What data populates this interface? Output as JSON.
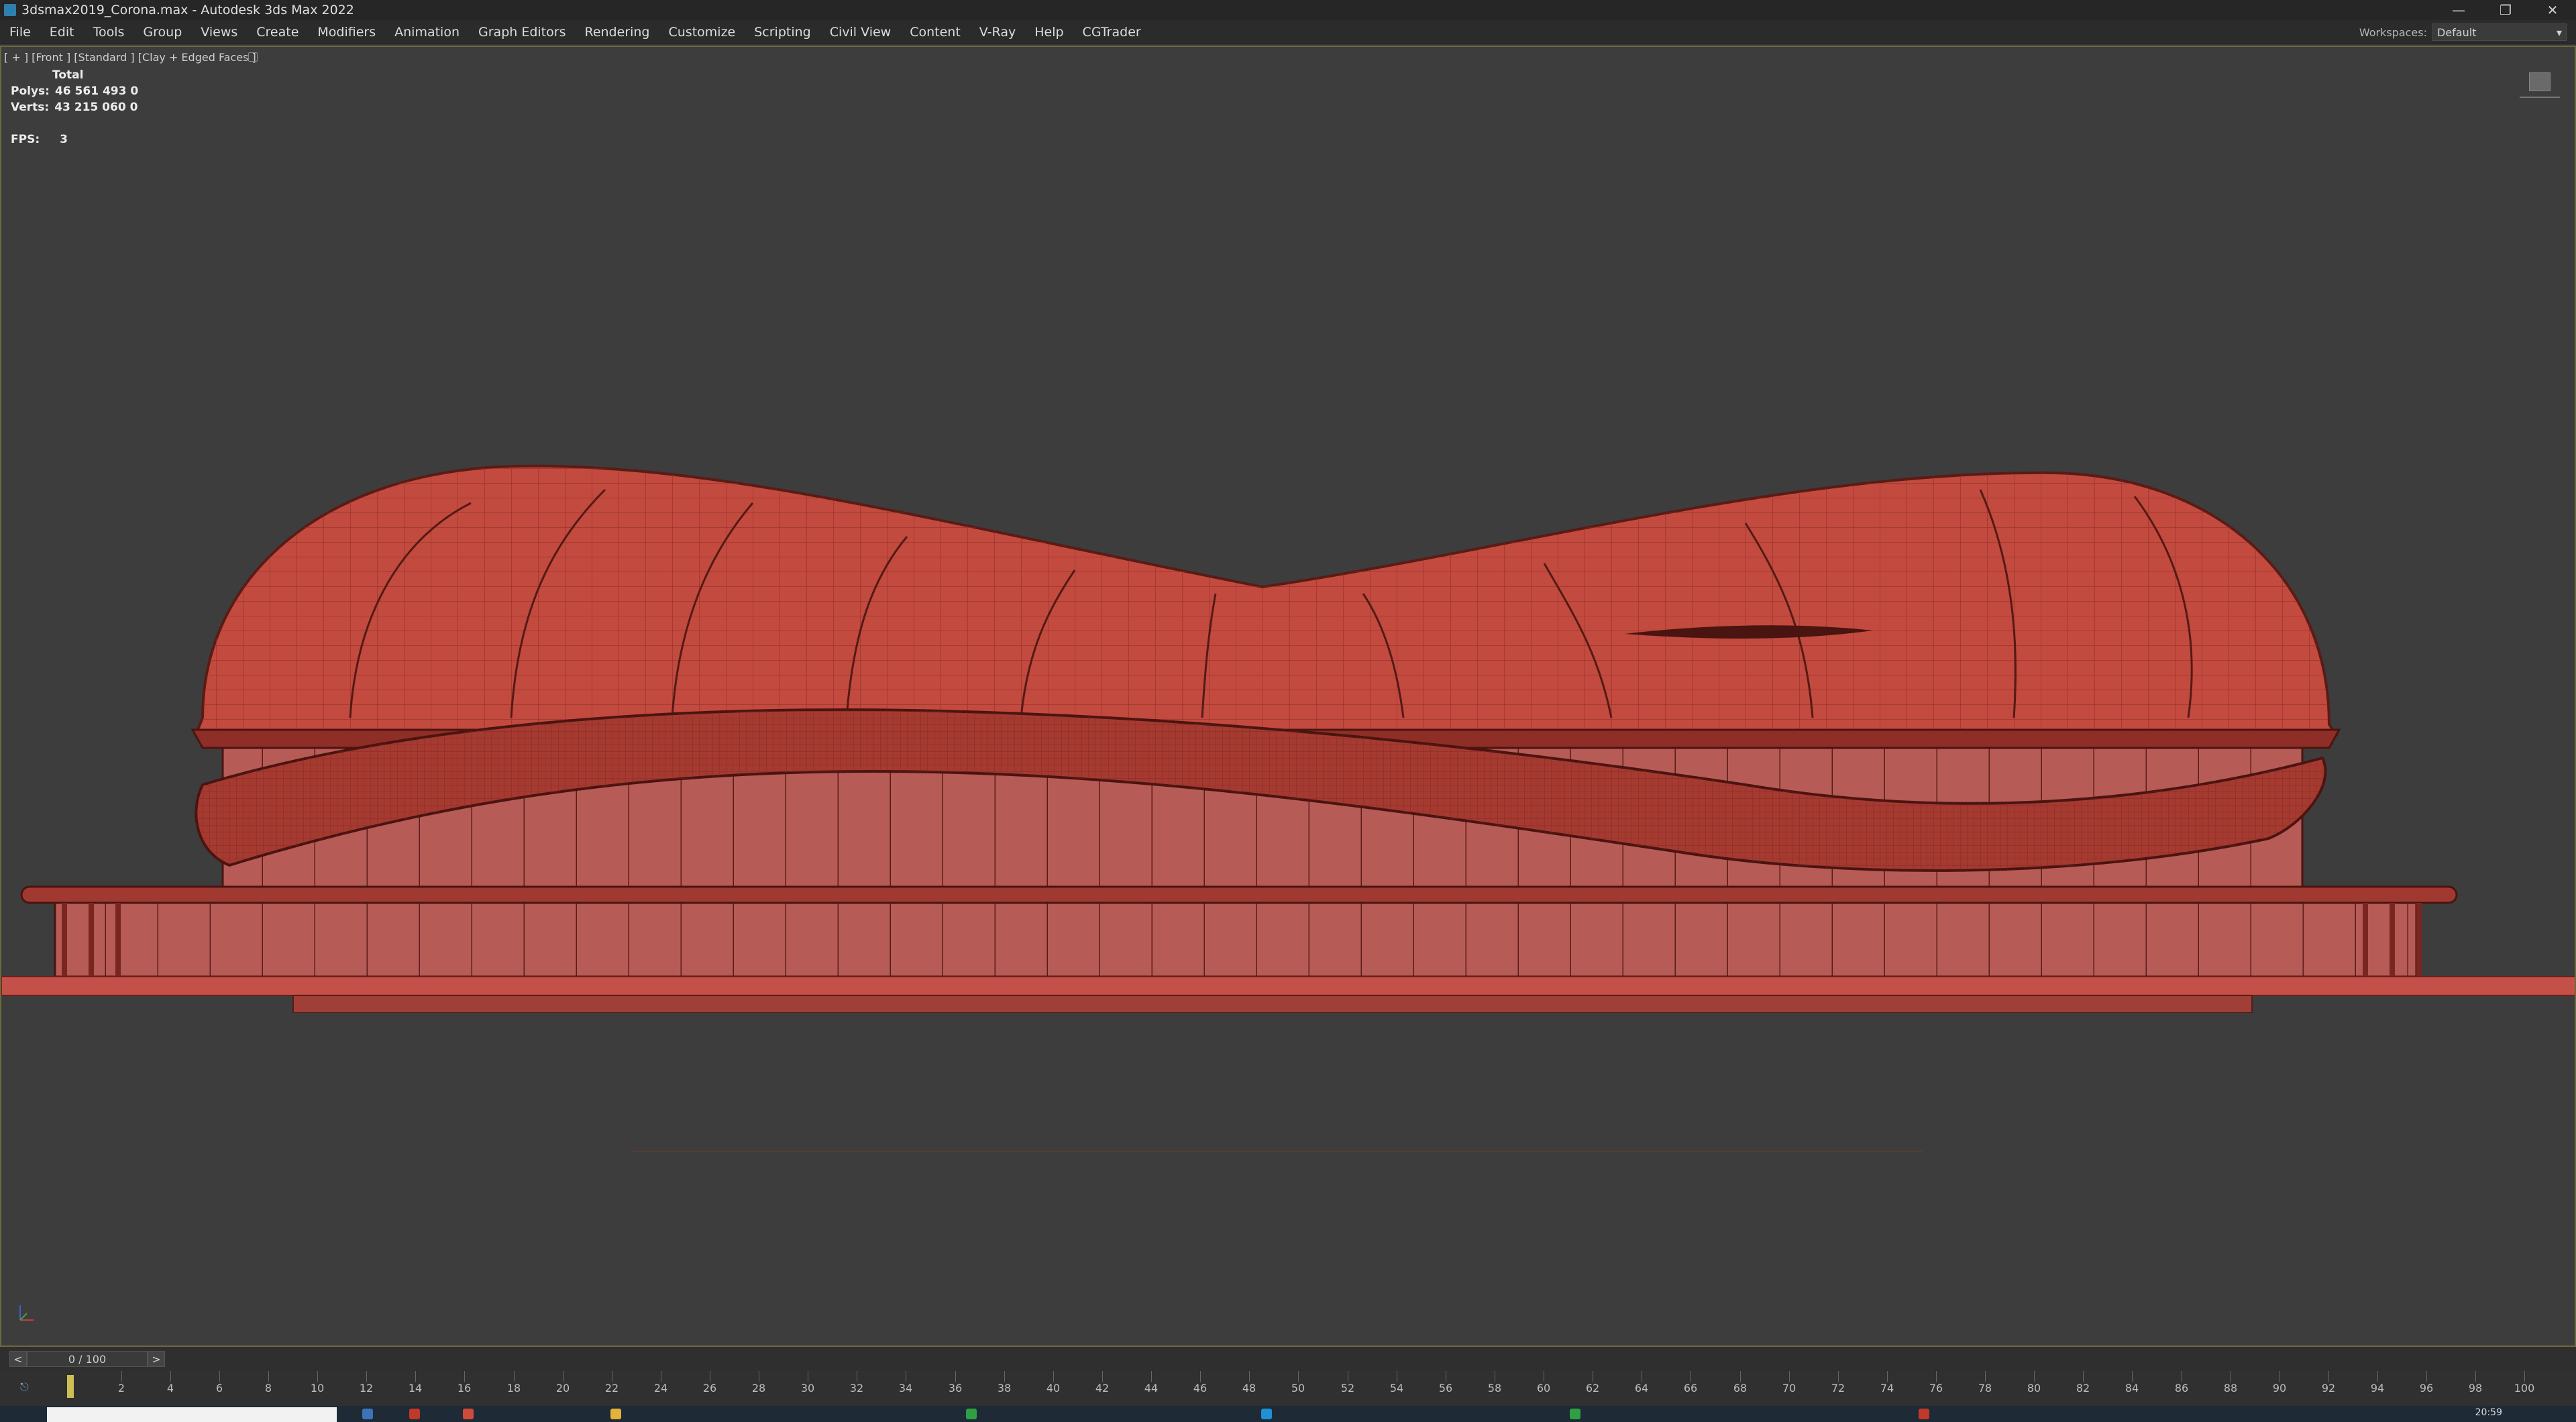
{
  "window": {
    "title": "3dsmax2019_Corona.max - Autodesk 3ds Max 2022",
    "minimize": "—",
    "restore": "❐",
    "close": "✕"
  },
  "menubar": {
    "items": [
      "File",
      "Edit",
      "Tools",
      "Group",
      "Views",
      "Create",
      "Modifiers",
      "Animation",
      "Graph Editors",
      "Rendering",
      "Customize",
      "Scripting",
      "Civil View",
      "Content",
      "V-Ray",
      "Help",
      "CGTrader"
    ],
    "workspace_label": "Workspaces:",
    "workspace_value": "Default"
  },
  "viewport": {
    "label": "[ + ] [Front ] [Standard ] [Clay + Edged Faces ]",
    "stats_header": "Total",
    "polys_label": "Polys:",
    "polys_value": "46 561 493 0",
    "verts_label": "Verts:",
    "verts_value": "43 215 060 0",
    "fps_label": "FPS:",
    "fps_value": "3",
    "model_color": "#c0473c"
  },
  "timeline": {
    "prev": "<",
    "frame": "0 / 100",
    "next": ">",
    "ticks": [
      "2",
      "4",
      "6",
      "8",
      "10",
      "12",
      "14",
      "16",
      "18",
      "20",
      "22",
      "24",
      "26",
      "28",
      "30",
      "32",
      "34",
      "36",
      "38",
      "40",
      "42",
      "44",
      "46",
      "48",
      "50",
      "52",
      "54",
      "56",
      "58",
      "60",
      "62",
      "64",
      "66",
      "68",
      "70",
      "72",
      "74",
      "76",
      "78",
      "80",
      "82",
      "84",
      "86",
      "88",
      "90",
      "92",
      "94",
      "96",
      "98",
      "100"
    ]
  },
  "taskbar": {
    "clock": "20:59"
  }
}
